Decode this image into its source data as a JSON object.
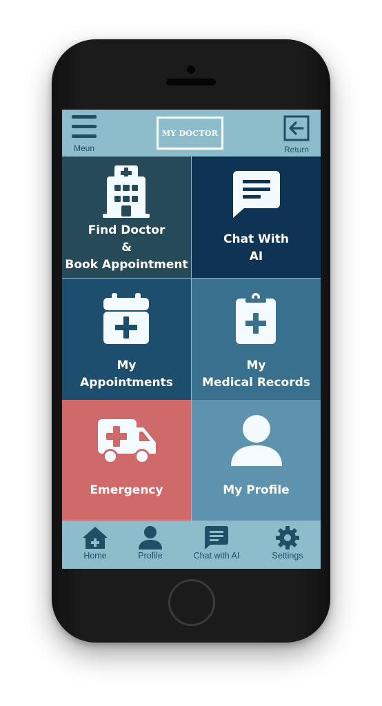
{
  "topbar": {
    "menu_label": "Meun",
    "logo_text": "MY DOCTOR",
    "return_label": "Return"
  },
  "tiles": [
    {
      "lines": [
        "Find Doctor",
        "&",
        "Book Appointment"
      ],
      "icon": "hospital-icon",
      "color": "#264a58"
    },
    {
      "lines": [
        "Chat With",
        "AI"
      ],
      "icon": "chat-message-icon",
      "color": "#0f3352"
    },
    {
      "lines": [
        "My",
        "Appointments"
      ],
      "icon": "calendar-plus-icon",
      "color": "#1e4e6e"
    },
    {
      "lines": [
        "My",
        "Medical Records"
      ],
      "icon": "clipboard-medical-icon",
      "color": "#38708e"
    },
    {
      "lines": [
        "Emergency"
      ],
      "icon": "ambulance-icon",
      "color": "#d06a6a"
    },
    {
      "lines": [
        "My Profile"
      ],
      "icon": "user-icon",
      "color": "#5d93ad"
    }
  ],
  "bottom_nav": [
    {
      "label": "Home",
      "icon": "home-icon"
    },
    {
      "label": "Profile",
      "icon": "user-icon"
    },
    {
      "label": "Chat with AI",
      "icon": "chat-icon"
    },
    {
      "label": "Settings",
      "icon": "gear-icon"
    }
  ],
  "colors": {
    "header_bg": "#8dbdcb",
    "icon_dark": "#1f4e66",
    "icon_light": "#f3fbff",
    "phone_body": "#1b1b1b"
  }
}
